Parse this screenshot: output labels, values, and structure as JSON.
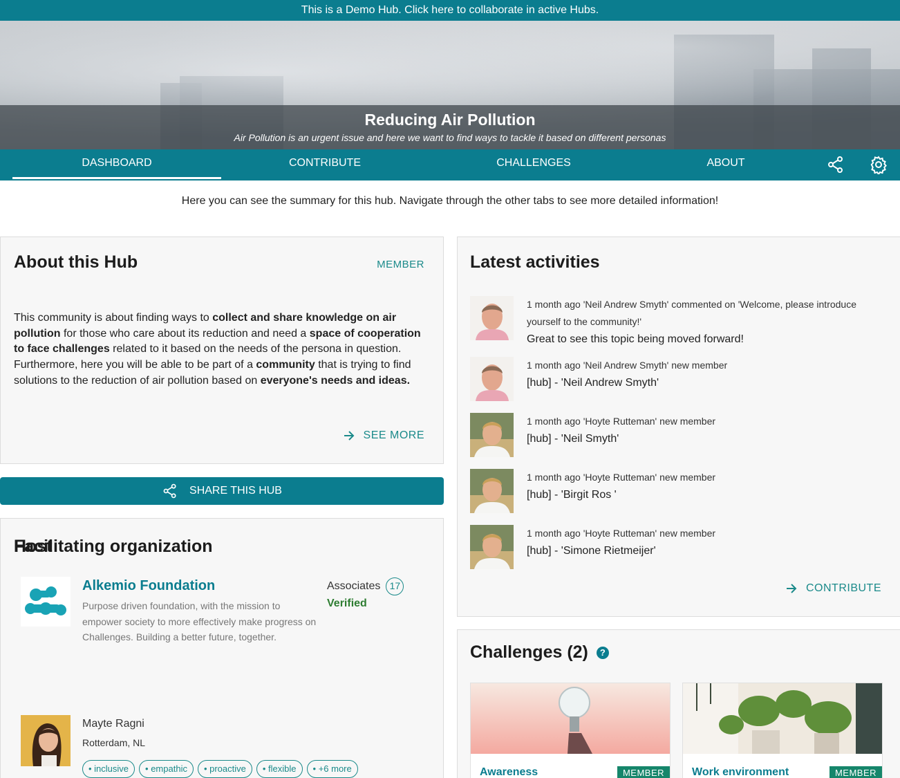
{
  "demo_bar": {
    "text": "This is a Demo Hub. Click here to collaborate in active Hubs."
  },
  "banner": {
    "title": "Reducing Air Pollution",
    "subtitle": "Air Pollution is an urgent issue and here we want to find ways to tackle it based on different personas"
  },
  "nav": {
    "tabs": [
      {
        "label": "DASHBOARD",
        "active": true
      },
      {
        "label": "CONTRIBUTE",
        "active": false
      },
      {
        "label": "CHALLENGES",
        "active": false
      },
      {
        "label": "ABOUT",
        "active": false
      }
    ],
    "icons": [
      "share-icon",
      "settings-gear-icon"
    ]
  },
  "summary": "Here you can see the summary for this hub. Navigate through the other tabs to see more detailed information!",
  "about": {
    "title": "About this Hub",
    "role": "MEMBER",
    "desc_parts": [
      "This community is about finding ways to ",
      "collect and share knowledge on air pollution",
      " for those who care about its reduction and need a ",
      "space of cooperation to face challenges",
      " related to it based on the needs of the persona in question. Furthermore, here you will be able to be part of a ",
      "community",
      " that is trying to find solutions to the reduction of air pollution based on ",
      "everyone's needs and ideas."
    ],
    "see_more": "SEE MORE"
  },
  "share_button": "SHARE THIS HUB",
  "facilitating": {
    "title": "Facilitating organization",
    "org_name": "Alkemio Foundation",
    "org_desc": "Purpose driven foundation, with the mission to empower society to more effectively make progress on Challenges. Building a better future, together.",
    "associates_label": "Associates",
    "associates_count": "17",
    "verified": "Verified"
  },
  "host": {
    "title": "Host",
    "name": "Mayte Ragni",
    "location": "Rotterdam, NL",
    "tags": [
      "inclusive",
      "empathic",
      "proactive",
      "flexible",
      "+6 more"
    ]
  },
  "latest": {
    "title": "Latest activities",
    "items": [
      {
        "meta": "1 month ago 'Neil Andrew Smyth' commented on 'Welcome, please introduce yourself to the community!'",
        "msg": "Great to see this topic being moved forward!",
        "avatar": "neil"
      },
      {
        "meta": "1 month ago 'Neil Andrew Smyth' new member",
        "msg": "[hub] - 'Neil Andrew Smyth'",
        "avatar": "neil"
      },
      {
        "meta": "1 month ago 'Hoyte Rutteman' new member",
        "msg": "[hub] - 'Neil Smyth'",
        "avatar": "hoyte"
      },
      {
        "meta": "1 month ago 'Hoyte Rutteman' new member",
        "msg": "[hub] - 'Birgit Ros '",
        "avatar": "hoyte"
      },
      {
        "meta": "1 month ago 'Hoyte Rutteman' new member",
        "msg": "[hub] - 'Simone Rietmeijer'",
        "avatar": "hoyte"
      }
    ],
    "contribute": "CONTRIBUTE"
  },
  "challenges": {
    "title": "Challenges (2)",
    "help": "?",
    "cards": [
      {
        "title": "Awareness",
        "badge": "MEMBER"
      },
      {
        "title": "Work environment",
        "badge": "MEMBER"
      }
    ]
  },
  "colors": {
    "brand": "#0b7d8f",
    "accent_text": "#1a8a8a",
    "verified": "#2e7d32",
    "member_badge": "#16866b"
  }
}
